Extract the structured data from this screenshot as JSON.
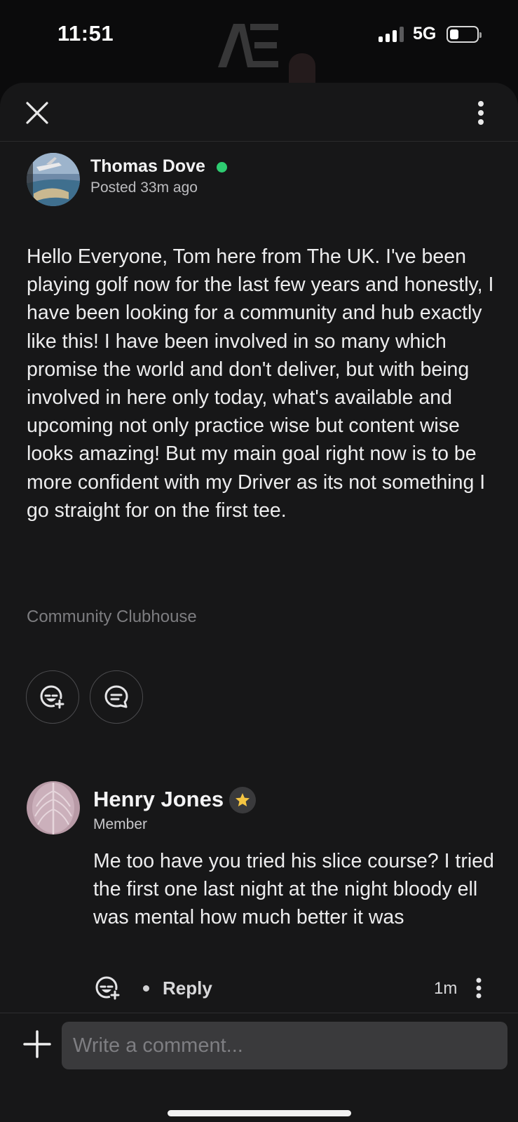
{
  "status_bar": {
    "time": "11:51",
    "network": "5G",
    "signal_bars_active": 3,
    "signal_bars_total": 4
  },
  "post": {
    "author": {
      "name": "Thomas Dove",
      "online": true,
      "posted": "Posted 33m ago"
    },
    "body": "Hello Everyone, Tom here from The UK. I've been playing golf now for the last few years and honestly, I have been looking for a community and hub exactly like this! I have been involved in so many which promise the world and don't deliver, but with being involved in here only today, what's available and upcoming not only practice wise but content wise looks amazing! But my main goal right now is to be more confident with my Driver as its not something I go straight for on the first tee.",
    "category": "Community Clubhouse"
  },
  "comments": [
    {
      "author": "Henry Jones",
      "role": "Member",
      "badge": "star-badge",
      "body": "Me too have you tried his slice course? I tried the first one last night at the night bloody ell was mental how much better it was",
      "reply_label": "Reply",
      "time": "1m"
    }
  ],
  "composer": {
    "placeholder": "Write a comment..."
  },
  "colors": {
    "sheet_background": "#171718",
    "online_indicator": "#2ecc71",
    "star_badge": "#f5c542",
    "input_background": "#3a3a3c"
  },
  "icons": {
    "close": "close-icon",
    "more": "more-vertical-icon",
    "react": "add-reaction-icon",
    "comment": "comment-bubble-icon",
    "add": "plus-icon"
  }
}
